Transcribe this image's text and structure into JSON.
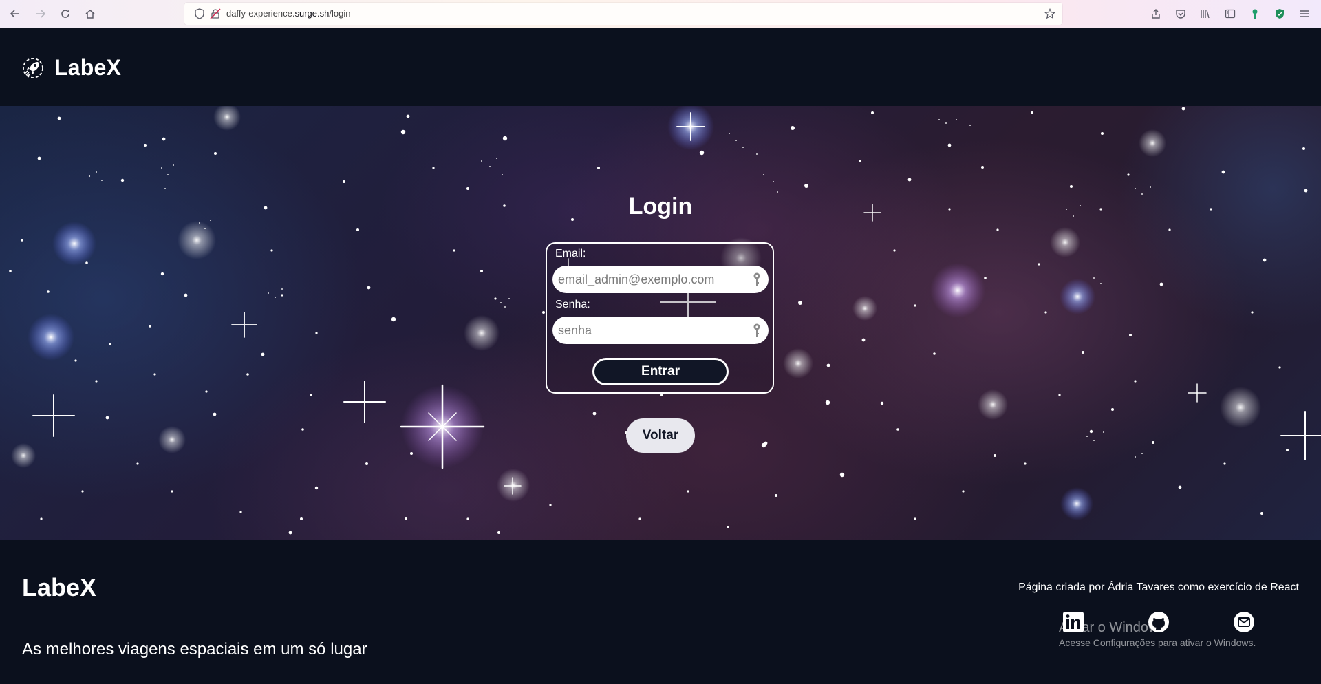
{
  "browser": {
    "url_prefix": "daffy-experience.",
    "url_host": "surge.sh",
    "url_path": "/login"
  },
  "header": {
    "logo_text": "LabeX",
    "logo_icon": "rocket-icon"
  },
  "login": {
    "title": "Login",
    "email_label": "Email:",
    "email_placeholder": "email_admin@exemplo.com",
    "password_label": "Senha:",
    "password_placeholder": "senha",
    "submit_label": "Entrar",
    "back_label": "Voltar"
  },
  "footer": {
    "brand": "LabeX",
    "slogan": "As melhores viagens espaciais em um só lugar",
    "credit": "Página criada por Ádria Tavares como exercício de React",
    "social": [
      "linkedin-icon",
      "github-icon",
      "email-icon"
    ]
  },
  "windows_watermark": {
    "line1": "Ativar o Windows",
    "line2": "Acesse Configurações para ativar o Windows."
  },
  "colors": {
    "header_bg": "#0b111e",
    "footer_bg": "#0b101d",
    "button_dark": "#111626",
    "button_light": "#e8e8ee"
  }
}
